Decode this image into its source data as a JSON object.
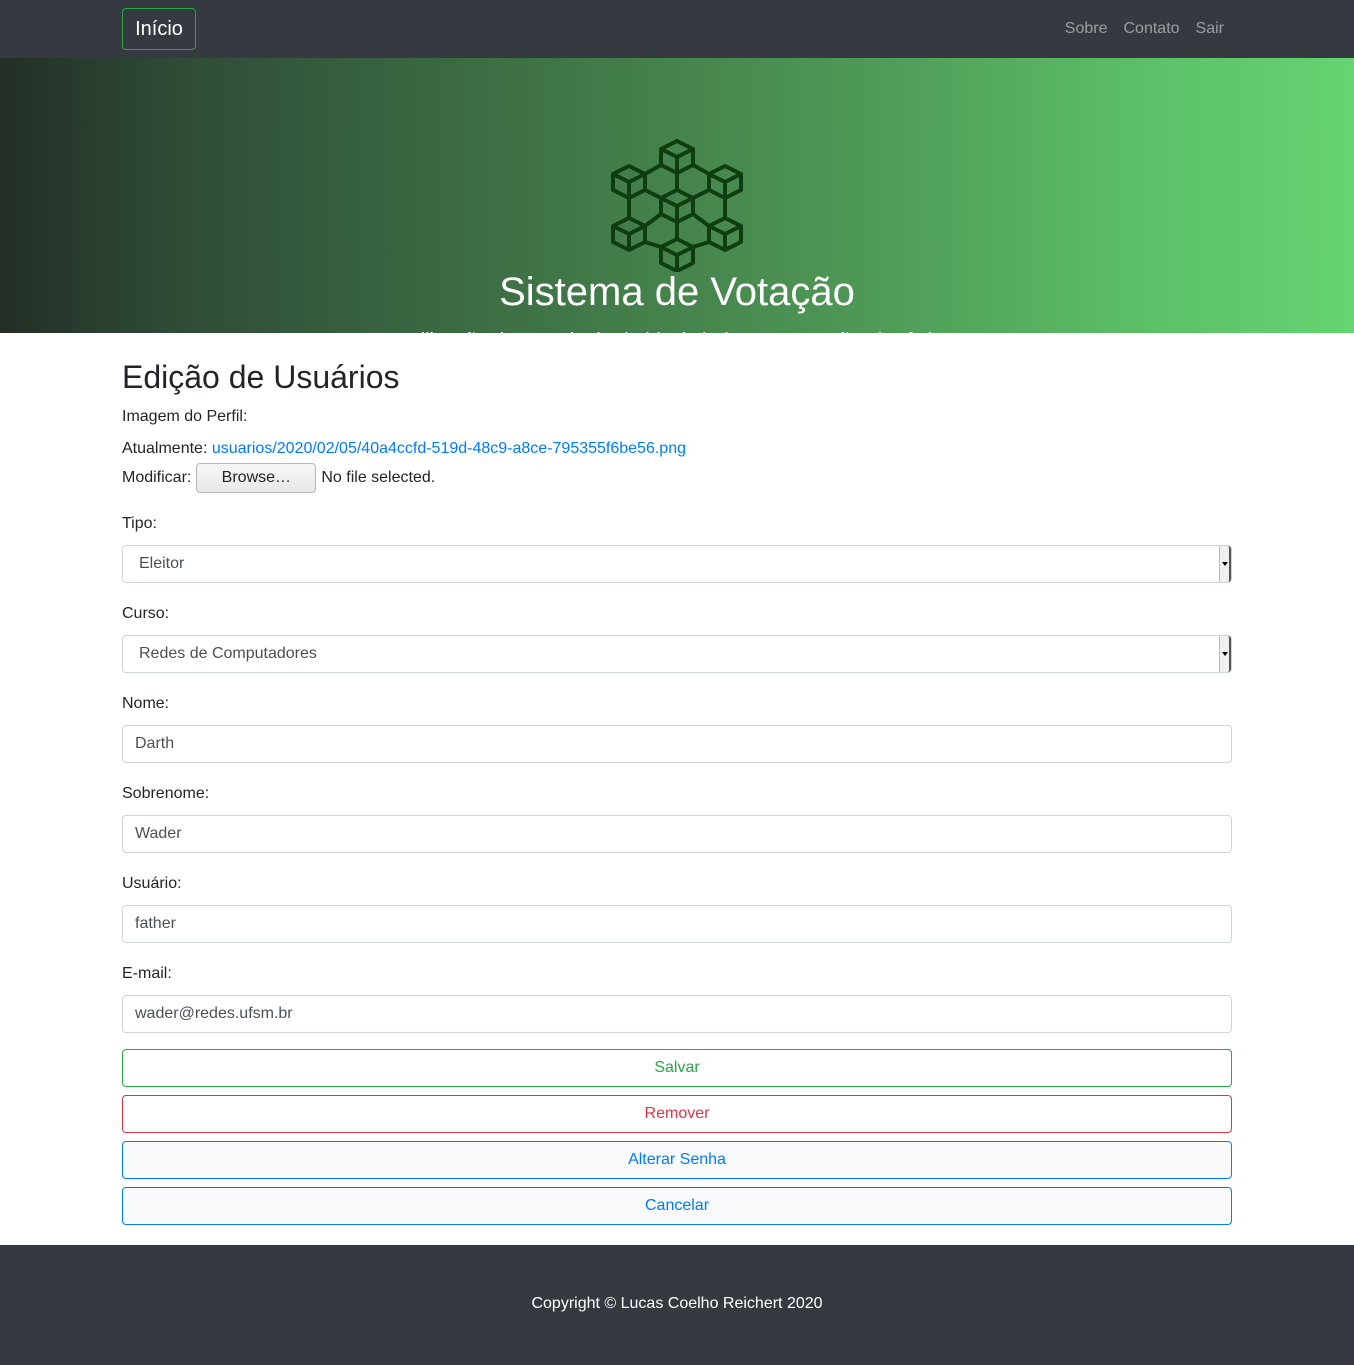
{
  "navbar": {
    "brand": "Início",
    "links": [
      "Sobre",
      "Contato",
      "Sair"
    ]
  },
  "hero": {
    "logo_icon": "blockchain-cubes-icon",
    "title": "Sistema de Votação",
    "subtitle": "Utilização da tecnologia de blockchain para votação eletrônica"
  },
  "form": {
    "title": "Edição de Usuários",
    "profile_image_label": "Imagem do Perfil:",
    "current_label": "Atualmente:",
    "current_file": "usuarios/2020/02/05/40a4ccfd-519d-48c9-a8ce-795355f6be56.png",
    "modify_label": "Modificar:",
    "browse_label": "Browse…",
    "no_file_text": "No file selected.",
    "tipo_label": "Tipo:",
    "tipo_value": "Eleitor",
    "curso_label": "Curso:",
    "curso_value": "Redes de Computadores",
    "nome_label": "Nome:",
    "nome_value": "Darth",
    "sobrenome_label": "Sobrenome:",
    "sobrenome_value": "Wader",
    "usuario_label": "Usuário:",
    "usuario_value": "father",
    "email_label": "E-mail:",
    "email_value": "wader@redes.ufsm.br",
    "buttons": {
      "save": "Salvar",
      "remove": "Remover",
      "change_password": "Alterar Senha",
      "cancel": "Cancelar"
    }
  },
  "footer": {
    "copyright": "Copyright © Lucas Coelho Reichert 2020"
  },
  "colors": {
    "navbar_bg": "#343a40",
    "success": "#28a745",
    "danger": "#dc3545",
    "primary": "#007bff",
    "logo": "#0f3d12"
  }
}
